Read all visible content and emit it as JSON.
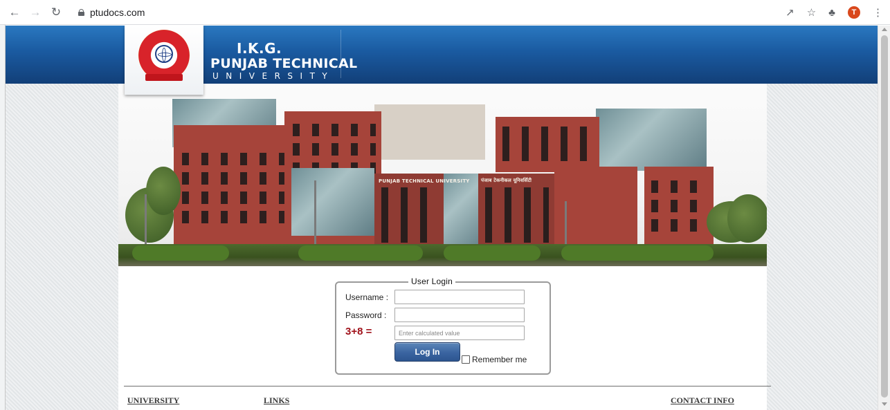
{
  "browser": {
    "url": "ptudocs.com",
    "avatar_letter": "T",
    "icons": [
      "back-arrow-icon",
      "forward-arrow-icon",
      "reload-icon",
      "lock-icon",
      "share-icon",
      "star-icon",
      "extensions-icon",
      "profile-avatar",
      "menu-dots-icon"
    ]
  },
  "header": {
    "brand_line1": "I.K.G.",
    "brand_line2": "PUNJAB TECHNICAL",
    "brand_line3": "UNIVERSITY",
    "band_color": "#1a5aa0"
  },
  "photo": {
    "sign_left": "PUNJAB TECHNICAL UNIVERSITY",
    "sign_right": "पंजाब टेकनीकल यूनिवर्सिटी"
  },
  "login": {
    "legend": "User Login",
    "username_label": "Username :",
    "username_value": "",
    "password_label": "Password :",
    "password_value": "",
    "captcha_question": "3+8 =",
    "captcha_placeholder": "Enter calculated value",
    "login_button": "Log In",
    "remember_label": "Remember me",
    "remember_checked": false,
    "captcha_color": "#a0121b",
    "button_color": "#3a64a0"
  },
  "footer": {
    "university": "UNIVERSITY",
    "links": "LINKS",
    "contact": "CONTACT INFO"
  }
}
